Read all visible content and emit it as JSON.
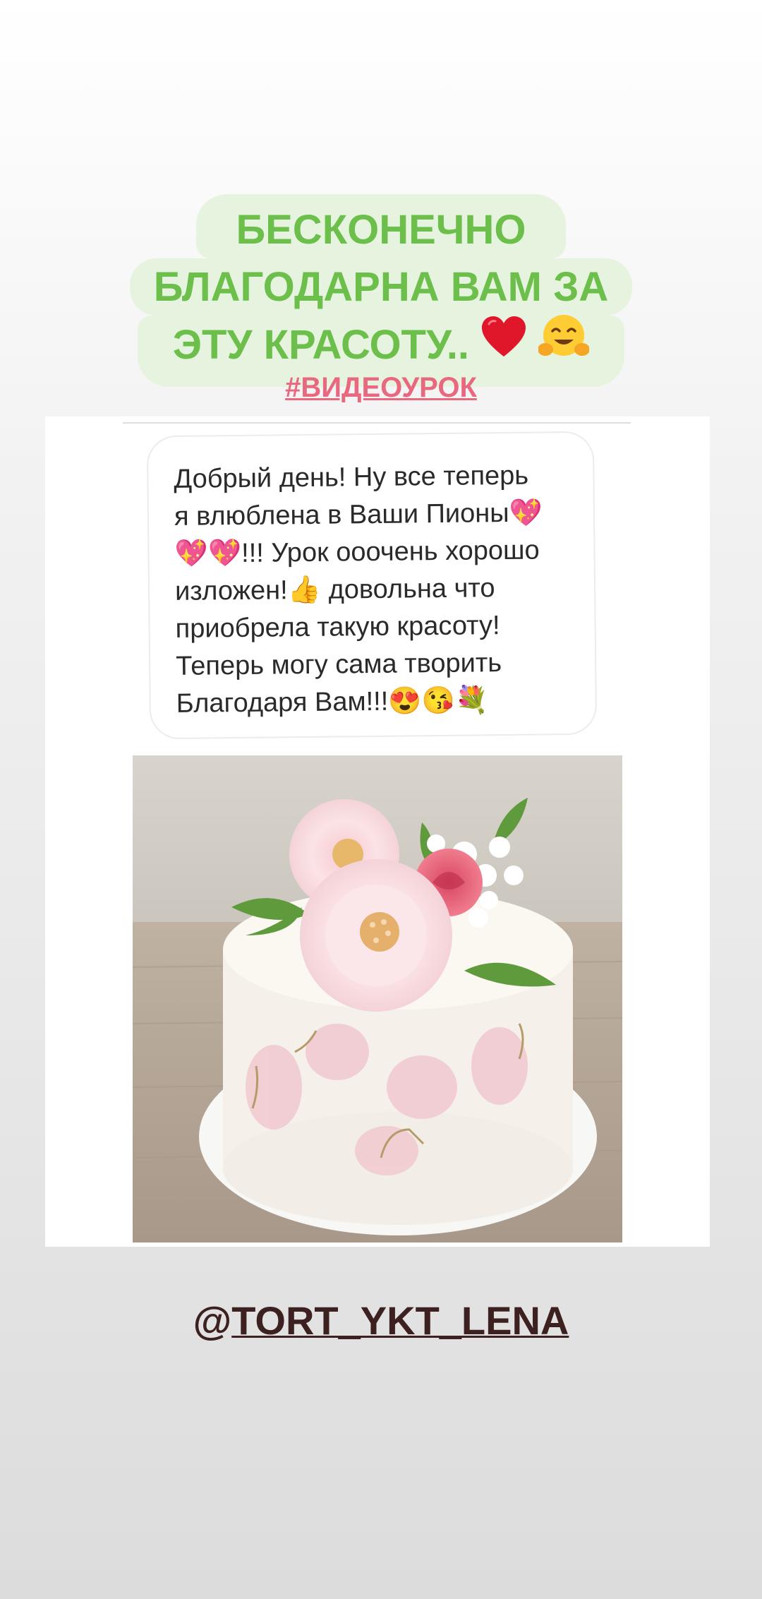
{
  "story": {
    "caption_lines": [
      "БЕСКОНЕЧНО",
      "БЛАГОДАРНА ВАМ ЗА",
      "ЭТУ КРАСОТУ.."
    ],
    "caption_emojis": [
      "heart-icon",
      "hugging-face-icon"
    ],
    "hashtag": "#ВИДЕОУРОК",
    "message": "Добрый день! Ну все теперь\nя влюблена в Ваши Пионы💖\n💖💖!!! Урок ооочень хорошо\nизложен!👍 довольна что\nприобрела такую красоту!\nТеперь могу сама творить\nБлагодаря Вам!!!😍😘💐",
    "photo_subject": "cake with peony decorations",
    "mention_prefix": "@",
    "mention_handle": "TORT_YKT_LENA"
  },
  "colors": {
    "caption_text": "#6bbf4a",
    "caption_bg": "#e6f3df",
    "hashtag": "#e8697f",
    "mention": "#3d2020"
  }
}
